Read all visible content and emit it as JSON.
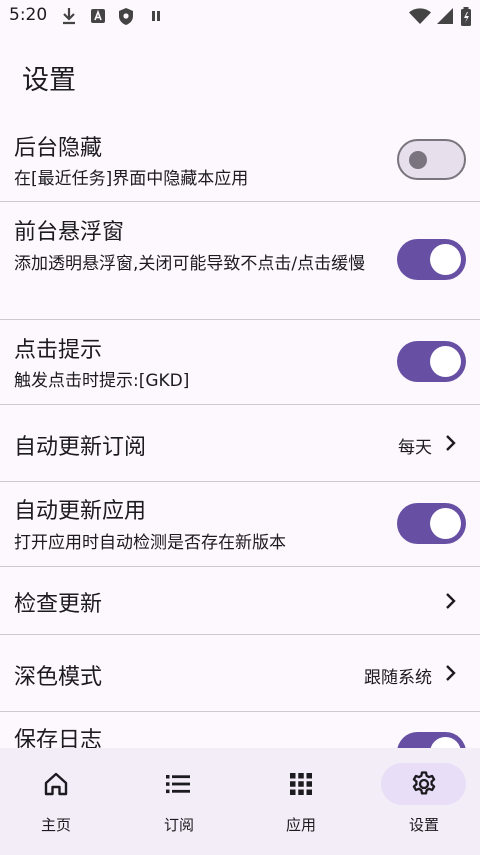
{
  "status_bar": {
    "time": "5:20",
    "icons": [
      "download-icon",
      "a-icon",
      "shield-icon",
      "pause-icon",
      "wifi-icon",
      "signal-icon",
      "battery-icon"
    ]
  },
  "page": {
    "title": "设置"
  },
  "settings": {
    "hide_background": {
      "label": "后台隐藏",
      "desc": "在[最近任务]界面中隐藏本应用",
      "enabled": false
    },
    "floating_window": {
      "label": "前台悬浮窗",
      "desc": "添加透明悬浮窗,关闭可能导致不点击/点击缓慢",
      "enabled": true
    },
    "click_hint": {
      "label": "点击提示",
      "desc": "触发点击时提示:[GKD]",
      "enabled": true
    },
    "auto_update_sub": {
      "label": "自动更新订阅",
      "value": "每天"
    },
    "auto_update_app": {
      "label": "自动更新应用",
      "desc": "打开应用时自动检测是否存在新版本",
      "enabled": true
    },
    "check_update": {
      "label": "检查更新"
    },
    "dark_mode": {
      "label": "深色模式",
      "value": "跟随系统"
    },
    "save_log": {
      "label": "保存日志",
      "enabled": true
    }
  },
  "nav": [
    {
      "label": "主页",
      "icon": "home-icon",
      "active": false
    },
    {
      "label": "订阅",
      "icon": "list-icon",
      "active": false
    },
    {
      "label": "应用",
      "icon": "apps-grid-icon",
      "active": false
    },
    {
      "label": "设置",
      "icon": "gear-icon",
      "active": true
    }
  ],
  "colors": {
    "accent": "#6750a4",
    "background": "#fdf8fd",
    "nav_background": "#f3edf7",
    "active_pill": "#e8def8"
  }
}
